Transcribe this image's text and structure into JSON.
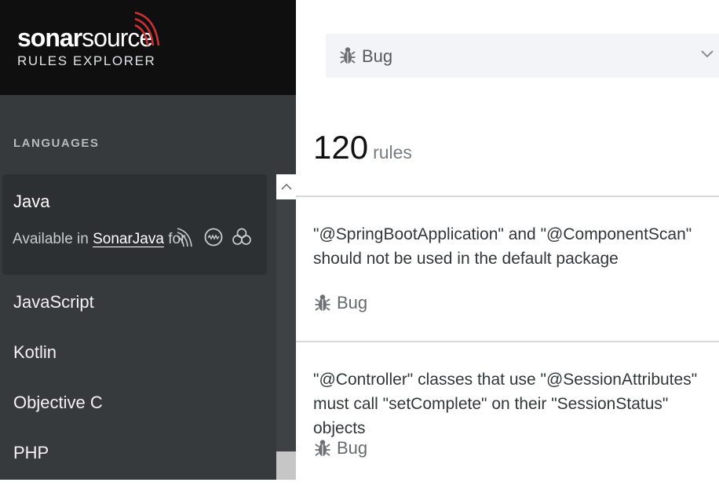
{
  "brand": {
    "name_bold": "sonar",
    "name_light": "source",
    "subtitle": "RULES EXPLORER",
    "accent_color": "#cb3032"
  },
  "sidebar": {
    "heading": "LANGUAGES",
    "active": {
      "label": "Java",
      "available_prefix": "Available in",
      "available_link": "SonarJava",
      "available_suffix": "for",
      "icons": [
        "sonarlint-icon",
        "sonarqube-icon",
        "sonarcloud-icon"
      ]
    },
    "items": [
      {
        "label": "JavaScript"
      },
      {
        "label": "Kotlin"
      },
      {
        "label": "Objective C"
      },
      {
        "label": "PHP"
      }
    ]
  },
  "filter": {
    "icon": "bug-icon",
    "selected": "Bug"
  },
  "results": {
    "count": "120",
    "unit": "rules"
  },
  "rules": [
    {
      "title": "\"@SpringBootApplication\" and \"@ComponentScan\" should not be used in the default package",
      "type": "Bug"
    },
    {
      "title": "\"@Controller\" classes that use \"@SessionAttributes\" must call \"setComplete\" on their \"SessionStatus\" objects",
      "type": "Bug"
    }
  ]
}
